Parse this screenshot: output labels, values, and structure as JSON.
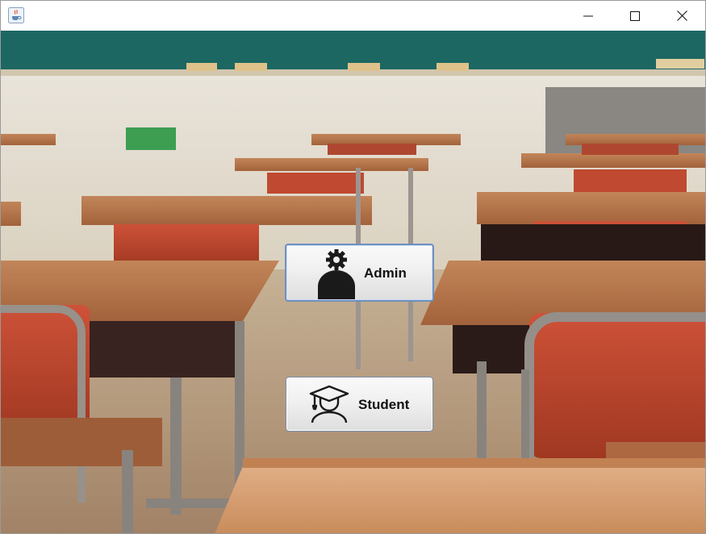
{
  "window": {
    "title": "",
    "app_icon": "java-cup-icon",
    "controls": {
      "minimize": "minimize-icon",
      "maximize": "maximize-icon",
      "close": "close-icon"
    }
  },
  "background": {
    "description_icon": "classroom-background-image"
  },
  "buttons": {
    "admin": {
      "label": "Admin",
      "icon": "admin-gear-person-icon"
    },
    "student": {
      "label": "Student",
      "icon": "student-graduation-cap-icon"
    }
  },
  "colors": {
    "accent_border": "#6f8fbf",
    "chalkboard": "#1f6f6a",
    "desk": "#b9744a",
    "chair": "#c8452b"
  }
}
